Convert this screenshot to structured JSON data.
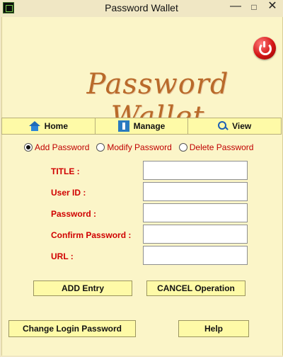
{
  "window": {
    "title": "Password Wallet",
    "controls": {
      "minimize": "—",
      "maximize": "□",
      "close": "✕"
    }
  },
  "logo_text": "Password Wallet",
  "nav": {
    "home": "Home",
    "manage": "Manage",
    "view": "View"
  },
  "mode_options": [
    {
      "label": "Add Password",
      "selected": true
    },
    {
      "label": "Modify Password",
      "selected": false
    },
    {
      "label": "Delete Password",
      "selected": false
    }
  ],
  "form": {
    "title_label": "TITLE :",
    "title_value": "",
    "userid_label": "User ID :",
    "userid_value": "",
    "password_label": "Password :",
    "password_value": "",
    "confirm_label": "Confirm Password :",
    "confirm_value": "",
    "url_label": "URL :",
    "url_value": ""
  },
  "buttons": {
    "add": "ADD Entry",
    "cancel": "CANCEL Operation",
    "change_login": "Change Login Password",
    "help": "Help"
  },
  "colors": {
    "background": "#fbf5c8",
    "accent_text": "#d00000",
    "button_fill": "#fefaa7",
    "logo": "#b96a2a"
  }
}
